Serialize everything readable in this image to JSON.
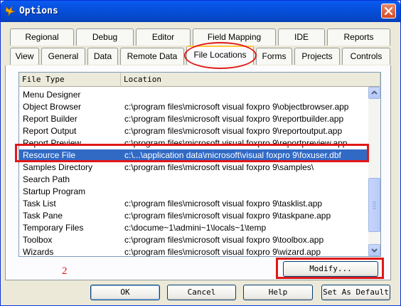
{
  "window": {
    "title": "Options",
    "icon": "fox-icon",
    "close_icon": "close-icon"
  },
  "tabs_row1": [
    "Regional",
    "Debug",
    "Editor",
    "Field Mapping",
    "IDE",
    "Reports"
  ],
  "tabs_row2": [
    "View",
    "General",
    "Data",
    "Remote Data",
    "File Locations",
    "Forms",
    "Projects",
    "Controls"
  ],
  "active_tab": "File Locations",
  "list": {
    "headers": [
      "File Type",
      "Location"
    ],
    "rows": [
      {
        "type": "Menu Designer",
        "location": ""
      },
      {
        "type": "Object Browser",
        "location": "c:\\program files\\microsoft visual foxpro 9\\objectbrowser.app"
      },
      {
        "type": "Report Builder",
        "location": "c:\\program files\\microsoft visual foxpro 9\\reportbuilder.app"
      },
      {
        "type": "Report Output",
        "location": "c:\\program files\\microsoft visual foxpro 9\\reportoutput.app"
      },
      {
        "type": "Report Preview",
        "location": "c:\\program files\\microsoft visual foxpro 9\\reportpreview.app"
      },
      {
        "type": "Resource File",
        "location": "c:\\...\\application data\\microsoft\\visual foxpro 9\\foxuser.dbf"
      },
      {
        "type": "Samples Directory",
        "location": "c:\\program files\\microsoft visual foxpro 9\\samples\\"
      },
      {
        "type": "Search Path",
        "location": ""
      },
      {
        "type": "Startup Program",
        "location": ""
      },
      {
        "type": "Task List",
        "location": "c:\\program files\\microsoft visual foxpro 9\\tasklist.app"
      },
      {
        "type": "Task Pane",
        "location": "c:\\program files\\microsoft visual foxpro 9\\taskpane.app"
      },
      {
        "type": "Temporary Files",
        "location": "c:\\docume~1\\admini~1\\locals~1\\temp"
      },
      {
        "type": "Toolbox",
        "location": "c:\\program files\\microsoft visual foxpro 9\\toolbox.app"
      },
      {
        "type": "Wizards",
        "location": "c:\\program files\\microsoft visual foxpro 9\\wizard.app"
      }
    ],
    "selected_index": 5
  },
  "buttons": {
    "modify": "Modify...",
    "ok": "OK",
    "cancel": "Cancel",
    "help": "Help",
    "set_default": "Set As Default"
  },
  "annotation_number": "2",
  "colors": {
    "annotation": "#e01818",
    "selection": "#316ac5",
    "titlebar": "#0650dd"
  }
}
